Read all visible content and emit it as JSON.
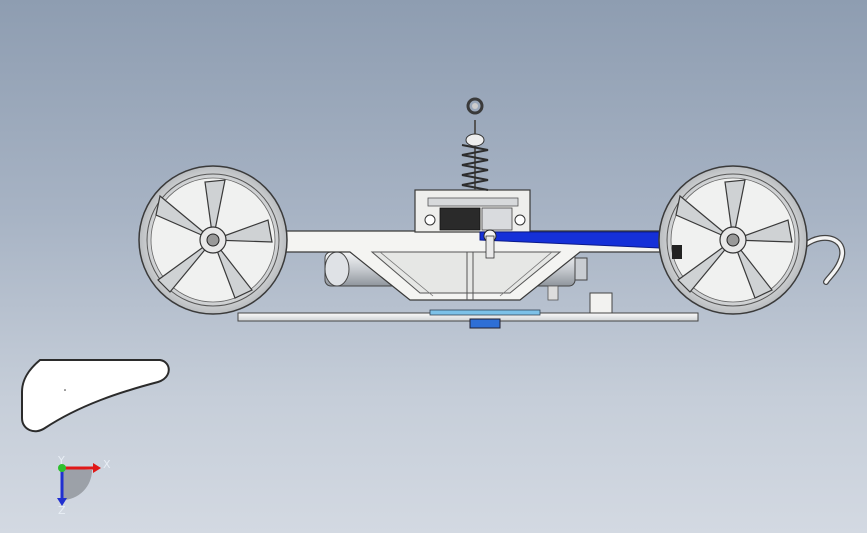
{
  "viewport": {
    "background_top": "#8e9db1",
    "background_bottom": "#d3d9e2"
  },
  "model": {
    "part_color": "#f2f3f1",
    "outline_color": "#3a3a3a",
    "highlight_color": "#1530d8",
    "motor_color": "#d8dbe0"
  },
  "triad": {
    "x_label": "X",
    "y_label": "Y",
    "z_label": "Z",
    "x_color": "#e01818",
    "y_color": "#2ec02e",
    "z_color": "#2030d0"
  }
}
